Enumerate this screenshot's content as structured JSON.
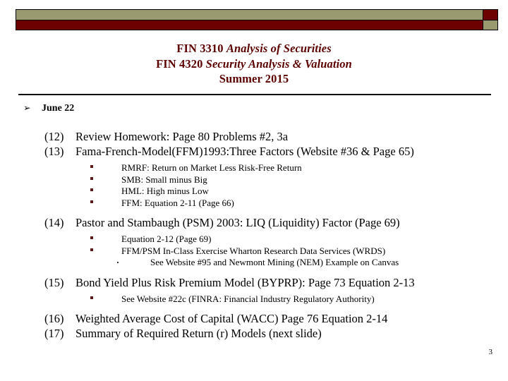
{
  "banner": {
    "olive_color": "#9a9a70",
    "maroon_color": "#6d0000"
  },
  "title": {
    "line1_prefix": "FIN 3310 ",
    "line1_italic": "Analysis of Securities",
    "line2_prefix": "FIN 4320 ",
    "line2_italic": "Security Analysis & Valuation",
    "line3": "Summer 2015",
    "color": "#5c0000"
  },
  "agenda": {
    "bullet_glyph": "➢",
    "date_label": "June 22"
  },
  "items": [
    {
      "number": "(12)",
      "text": "Review Homework: Page 80 Problems #2, 3a"
    },
    {
      "number": "(13)",
      "text": "Fama-French-Model(FFM)1993:Three Factors (Website #36 & Page 65)",
      "subitems": [
        "RMRF: Return on Market Less Risk-Free Return",
        "SMB: Small minus Big",
        "HML: High minus Low",
        "FFM: Equation 2-11 (Page 66)"
      ]
    },
    {
      "number": "(14)",
      "text": "Pastor and Stambaugh (PSM) 2003: LIQ (Liquidity) Factor (Page 69)",
      "subitems": [
        "Equation 2-12 (Page 69)",
        "FFM/PSM In-Class Exercise Wharton Research Data Services (WRDS)"
      ],
      "subsubitems": [
        "See Website #95 and Newmont Mining (NEM) Example on Canvas"
      ]
    },
    {
      "number": "(15)",
      "text": "Bond Yield Plus Risk Premium Model (BYPRP): Page 73 Equation 2-13",
      "subitems": [
        "See Website #22c (FINRA: Financial Industry Regulatory Authority)"
      ]
    },
    {
      "number": "(16)",
      "text": "Weighted Average Cost of Capital (WACC) Page 76 Equation 2-14"
    },
    {
      "number": "(17)",
      "text": "Summary of Required Return (r) Models (next slide)"
    }
  ],
  "footer": {
    "slide_number": "3"
  }
}
